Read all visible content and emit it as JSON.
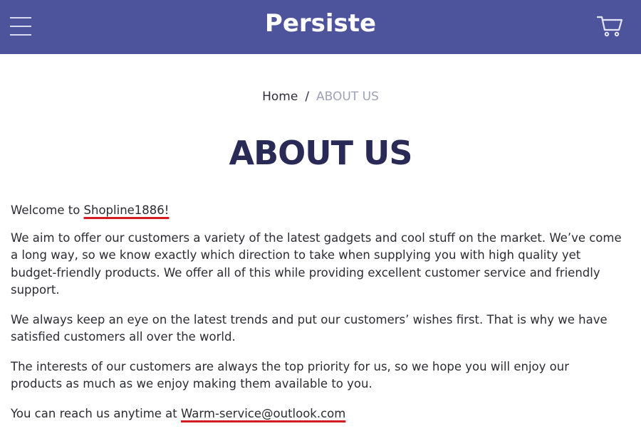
{
  "header": {
    "brand": "Persiste",
    "background_color": "#4e549c",
    "menu_icon": "hamburger-menu-icon",
    "cart_icon": "shopping-cart-icon"
  },
  "breadcrumb": {
    "home": "Home",
    "separator": "/",
    "current": "ABOUT US"
  },
  "page": {
    "title": "ABOUT US"
  },
  "content": {
    "welcome_prefix": "Welcome to ",
    "welcome_store": "Shopline1886!",
    "paragraph_1": "We aim to offer our customers a variety of the latest gadgets and cool stuff on the market. We’ve come a long way, so we know exactly which direction to take when supplying you with high quality yet budget-friendly products. We offer all of this while providing excellent customer service and friendly support.",
    "paragraph_2": "We always keep an eye on the latest trends and put our customers’ wishes first. That is why we have satisfied customers all over the world.",
    "paragraph_3": "The interests of our customers are always the top priority for us, so we hope you will enjoy our products as much as we enjoy making them available to you.",
    "contact_prefix": "You can reach us anytime at ",
    "contact_email": "Warm-service@outlook.com",
    "highlight_color": "#d61a22"
  }
}
